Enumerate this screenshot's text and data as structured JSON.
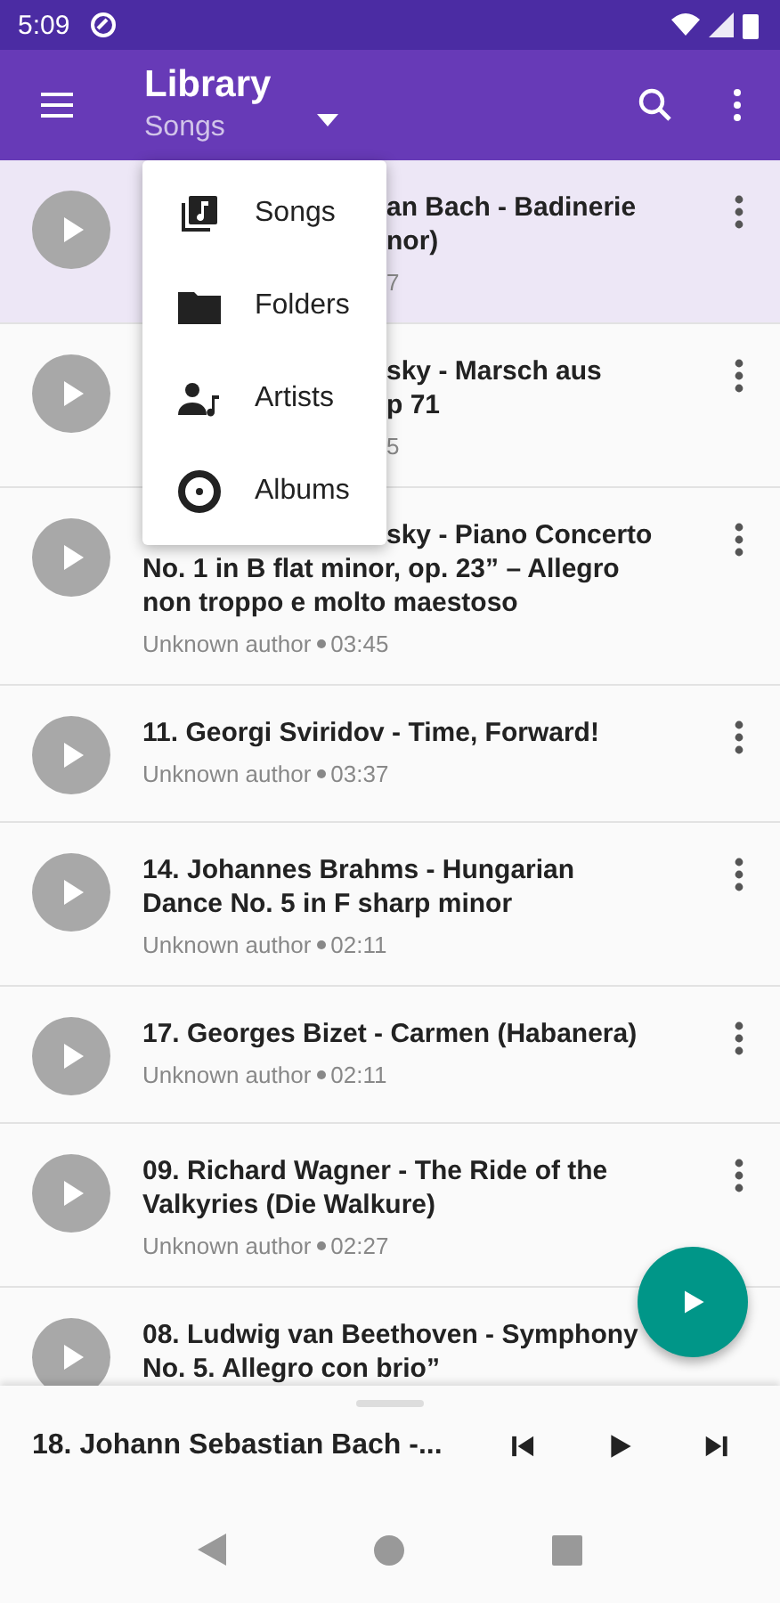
{
  "status_bar": {
    "time": "5:09"
  },
  "toolbar": {
    "title": "Library",
    "subtitle": "Songs"
  },
  "menu": [
    {
      "kind": "songs",
      "label": "Songs"
    },
    {
      "kind": "folders",
      "label": "Folders"
    },
    {
      "kind": "artists",
      "label": "Artists"
    },
    {
      "kind": "albums",
      "label": "Albums"
    }
  ],
  "songs": [
    {
      "kind": "covered",
      "playing": true,
      "title_lines": [
        "an Bach - Badinerie",
        "nor)"
      ],
      "meta": "7"
    },
    {
      "kind": "covered",
      "playing": false,
      "title_lines": [
        "sky - Marsch aus",
        "p 71"
      ],
      "meta": "5"
    },
    {
      "kind": "covered-top",
      "playing": false,
      "title_lines": [
        "sky - Piano Concerto",
        "No. 1 in B flat minor, op. 23” – Allegro",
        "non troppo e molto maestoso"
      ],
      "author": "Unknown author",
      "duration": "03:45"
    },
    {
      "kind": "full",
      "playing": false,
      "title_lines": [
        "11. Georgi Sviridov - Time, Forward!"
      ],
      "author": "Unknown author",
      "duration": "03:37"
    },
    {
      "kind": "full",
      "playing": false,
      "title_lines": [
        "14. Johannes Brahms - Hungarian",
        "Dance No. 5 in F sharp minor"
      ],
      "author": "Unknown author",
      "duration": "02:11"
    },
    {
      "kind": "full",
      "playing": false,
      "title_lines": [
        "17. Georges Bizet - Carmen (Habanera)"
      ],
      "author": "Unknown author",
      "duration": "02:11"
    },
    {
      "kind": "full",
      "playing": false,
      "title_lines": [
        "09. Richard Wagner - The Ride of the",
        "Valkyries (Die Walkure)"
      ],
      "author": "Unknown author",
      "duration": "02:27"
    },
    {
      "kind": "full",
      "playing": false,
      "title_lines": [
        "08. Ludwig van Beethoven - Symphony",
        "No. 5. Allegro con brio”"
      ]
    }
  ],
  "now_playing": {
    "title": "18. Johann Sebastian Bach -..."
  }
}
